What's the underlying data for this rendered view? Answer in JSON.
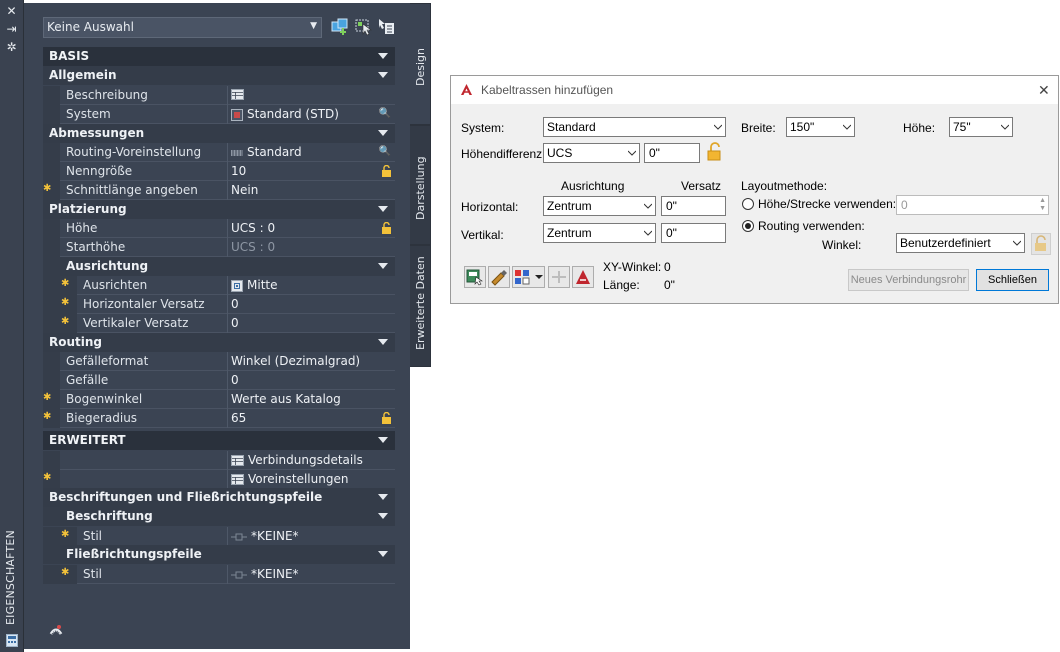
{
  "palette": {
    "strip_title": "EIGENSCHAFTEN",
    "selection": "Keine Auswahl",
    "tabs": [
      "Design",
      "Darstellung",
      "Erweiterte Daten"
    ],
    "sections": {
      "basis": "BASIS",
      "allgemein": "Allgemein",
      "abmessungen": "Abmessungen",
      "platzierung": "Platzierung",
      "ausrichtung": "Ausrichtung",
      "routing": "Routing",
      "erweitert": "ERWEITERT",
      "beschriftungen": "Beschriftungen und Fließrichtungspfeile",
      "beschriftung": "Beschriftung",
      "fliessrichtungspfeile": "Fließrichtungspfeile"
    },
    "props": {
      "beschreibung": {
        "label": "Beschreibung",
        "value": ""
      },
      "system": {
        "label": "System",
        "value": "Standard (STD)"
      },
      "routing_voreinstellung": {
        "label": "Routing-Voreinstellung",
        "value": "Standard"
      },
      "nenngroesse": {
        "label": "Nenngröße",
        "value": "10"
      },
      "schnittlaenge": {
        "label": "Schnittlänge angeben",
        "value": "Nein"
      },
      "hoehe": {
        "label": "Höhe",
        "value": "UCS : 0"
      },
      "starthoehe": {
        "label": "Starthöhe",
        "value": "UCS : 0"
      },
      "ausrichten": {
        "label": "Ausrichten",
        "value": "Mitte"
      },
      "hor_versatz": {
        "label": "Horizontaler Versatz",
        "value": "0"
      },
      "vert_versatz": {
        "label": "Vertikaler Versatz",
        "value": "0"
      },
      "gefaelleformat": {
        "label": "Gefälleformat",
        "value": "Winkel (Dezimalgrad)"
      },
      "gefaelle": {
        "label": "Gefälle",
        "value": "0"
      },
      "bogenwinkel": {
        "label": "Bogenwinkel",
        "value": "Werte aus Katalog"
      },
      "biegeradius": {
        "label": "Biegeradius",
        "value": "65"
      },
      "verbindungsdetails": {
        "value": "Verbindungsdetails"
      },
      "voreinstellungen": {
        "value": "Voreinstellungen"
      },
      "stil1": {
        "label": "Stil",
        "value": "*KEINE*"
      },
      "stil2": {
        "label": "Stil",
        "value": "*KEINE*"
      }
    }
  },
  "dialog": {
    "title": "Kabeltrassen hinzufügen",
    "system_label": "System:",
    "system_value": "Standard",
    "breite_label": "Breite:",
    "breite_value": "150\"",
    "hoehe_label": "Höhe:",
    "hoehe_value": "75\"",
    "hoehendiff_label": "Höhendifferenz",
    "hoehendiff_value": "UCS",
    "hoehendiff_offset": "0\"",
    "ausrichtung_header": "Ausrichtung",
    "versatz_header": "Versatz",
    "horizontal_label": "Horizontal:",
    "horizontal_value": "Zentrum",
    "horizontal_offset": "0\"",
    "vertikal_label": "Vertikal:",
    "vertikal_value": "Zentrum",
    "vertikal_offset": "0\"",
    "layout_label": "Layoutmethode:",
    "radio1_label": "Höhe/Strecke verwenden:",
    "radio1_value": "0",
    "radio2_label": "Routing verwenden:",
    "winkel_label": "Winkel:",
    "winkel_value": "Benutzerdefiniert",
    "xy_label": "XY-Winkel:",
    "xy_value": "0",
    "laenge_label": "Länge:",
    "laenge_value": "0\"",
    "neues_btn": "Neues Verbindungsrohr",
    "schliessen_btn": "Schließen"
  }
}
